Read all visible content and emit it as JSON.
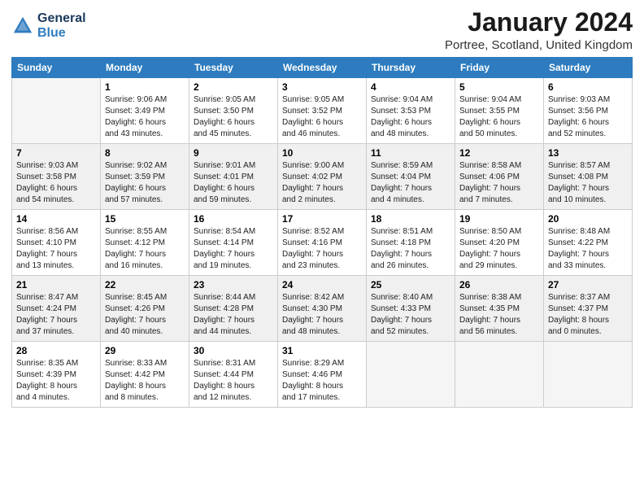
{
  "header": {
    "title": "January 2024",
    "subtitle": "Portree, Scotland, United Kingdom",
    "logo_text_general": "General",
    "logo_text_blue": "Blue"
  },
  "days_of_week": [
    "Sunday",
    "Monday",
    "Tuesday",
    "Wednesday",
    "Thursday",
    "Friday",
    "Saturday"
  ],
  "weeks": [
    [
      {
        "day": "",
        "info": ""
      },
      {
        "day": "1",
        "info": "Sunrise: 9:06 AM\nSunset: 3:49 PM\nDaylight: 6 hours\nand 43 minutes."
      },
      {
        "day": "2",
        "info": "Sunrise: 9:05 AM\nSunset: 3:50 PM\nDaylight: 6 hours\nand 45 minutes."
      },
      {
        "day": "3",
        "info": "Sunrise: 9:05 AM\nSunset: 3:52 PM\nDaylight: 6 hours\nand 46 minutes."
      },
      {
        "day": "4",
        "info": "Sunrise: 9:04 AM\nSunset: 3:53 PM\nDaylight: 6 hours\nand 48 minutes."
      },
      {
        "day": "5",
        "info": "Sunrise: 9:04 AM\nSunset: 3:55 PM\nDaylight: 6 hours\nand 50 minutes."
      },
      {
        "day": "6",
        "info": "Sunrise: 9:03 AM\nSunset: 3:56 PM\nDaylight: 6 hours\nand 52 minutes."
      }
    ],
    [
      {
        "day": "7",
        "info": "Sunrise: 9:03 AM\nSunset: 3:58 PM\nDaylight: 6 hours\nand 54 minutes."
      },
      {
        "day": "8",
        "info": "Sunrise: 9:02 AM\nSunset: 3:59 PM\nDaylight: 6 hours\nand 57 minutes."
      },
      {
        "day": "9",
        "info": "Sunrise: 9:01 AM\nSunset: 4:01 PM\nDaylight: 6 hours\nand 59 minutes."
      },
      {
        "day": "10",
        "info": "Sunrise: 9:00 AM\nSunset: 4:02 PM\nDaylight: 7 hours\nand 2 minutes."
      },
      {
        "day": "11",
        "info": "Sunrise: 8:59 AM\nSunset: 4:04 PM\nDaylight: 7 hours\nand 4 minutes."
      },
      {
        "day": "12",
        "info": "Sunrise: 8:58 AM\nSunset: 4:06 PM\nDaylight: 7 hours\nand 7 minutes."
      },
      {
        "day": "13",
        "info": "Sunrise: 8:57 AM\nSunset: 4:08 PM\nDaylight: 7 hours\nand 10 minutes."
      }
    ],
    [
      {
        "day": "14",
        "info": "Sunrise: 8:56 AM\nSunset: 4:10 PM\nDaylight: 7 hours\nand 13 minutes."
      },
      {
        "day": "15",
        "info": "Sunrise: 8:55 AM\nSunset: 4:12 PM\nDaylight: 7 hours\nand 16 minutes."
      },
      {
        "day": "16",
        "info": "Sunrise: 8:54 AM\nSunset: 4:14 PM\nDaylight: 7 hours\nand 19 minutes."
      },
      {
        "day": "17",
        "info": "Sunrise: 8:52 AM\nSunset: 4:16 PM\nDaylight: 7 hours\nand 23 minutes."
      },
      {
        "day": "18",
        "info": "Sunrise: 8:51 AM\nSunset: 4:18 PM\nDaylight: 7 hours\nand 26 minutes."
      },
      {
        "day": "19",
        "info": "Sunrise: 8:50 AM\nSunset: 4:20 PM\nDaylight: 7 hours\nand 29 minutes."
      },
      {
        "day": "20",
        "info": "Sunrise: 8:48 AM\nSunset: 4:22 PM\nDaylight: 7 hours\nand 33 minutes."
      }
    ],
    [
      {
        "day": "21",
        "info": "Sunrise: 8:47 AM\nSunset: 4:24 PM\nDaylight: 7 hours\nand 37 minutes."
      },
      {
        "day": "22",
        "info": "Sunrise: 8:45 AM\nSunset: 4:26 PM\nDaylight: 7 hours\nand 40 minutes."
      },
      {
        "day": "23",
        "info": "Sunrise: 8:44 AM\nSunset: 4:28 PM\nDaylight: 7 hours\nand 44 minutes."
      },
      {
        "day": "24",
        "info": "Sunrise: 8:42 AM\nSunset: 4:30 PM\nDaylight: 7 hours\nand 48 minutes."
      },
      {
        "day": "25",
        "info": "Sunrise: 8:40 AM\nSunset: 4:33 PM\nDaylight: 7 hours\nand 52 minutes."
      },
      {
        "day": "26",
        "info": "Sunrise: 8:38 AM\nSunset: 4:35 PM\nDaylight: 7 hours\nand 56 minutes."
      },
      {
        "day": "27",
        "info": "Sunrise: 8:37 AM\nSunset: 4:37 PM\nDaylight: 8 hours\nand 0 minutes."
      }
    ],
    [
      {
        "day": "28",
        "info": "Sunrise: 8:35 AM\nSunset: 4:39 PM\nDaylight: 8 hours\nand 4 minutes."
      },
      {
        "day": "29",
        "info": "Sunrise: 8:33 AM\nSunset: 4:42 PM\nDaylight: 8 hours\nand 8 minutes."
      },
      {
        "day": "30",
        "info": "Sunrise: 8:31 AM\nSunset: 4:44 PM\nDaylight: 8 hours\nand 12 minutes."
      },
      {
        "day": "31",
        "info": "Sunrise: 8:29 AM\nSunset: 4:46 PM\nDaylight: 8 hours\nand 17 minutes."
      },
      {
        "day": "",
        "info": ""
      },
      {
        "day": "",
        "info": ""
      },
      {
        "day": "",
        "info": ""
      }
    ]
  ]
}
